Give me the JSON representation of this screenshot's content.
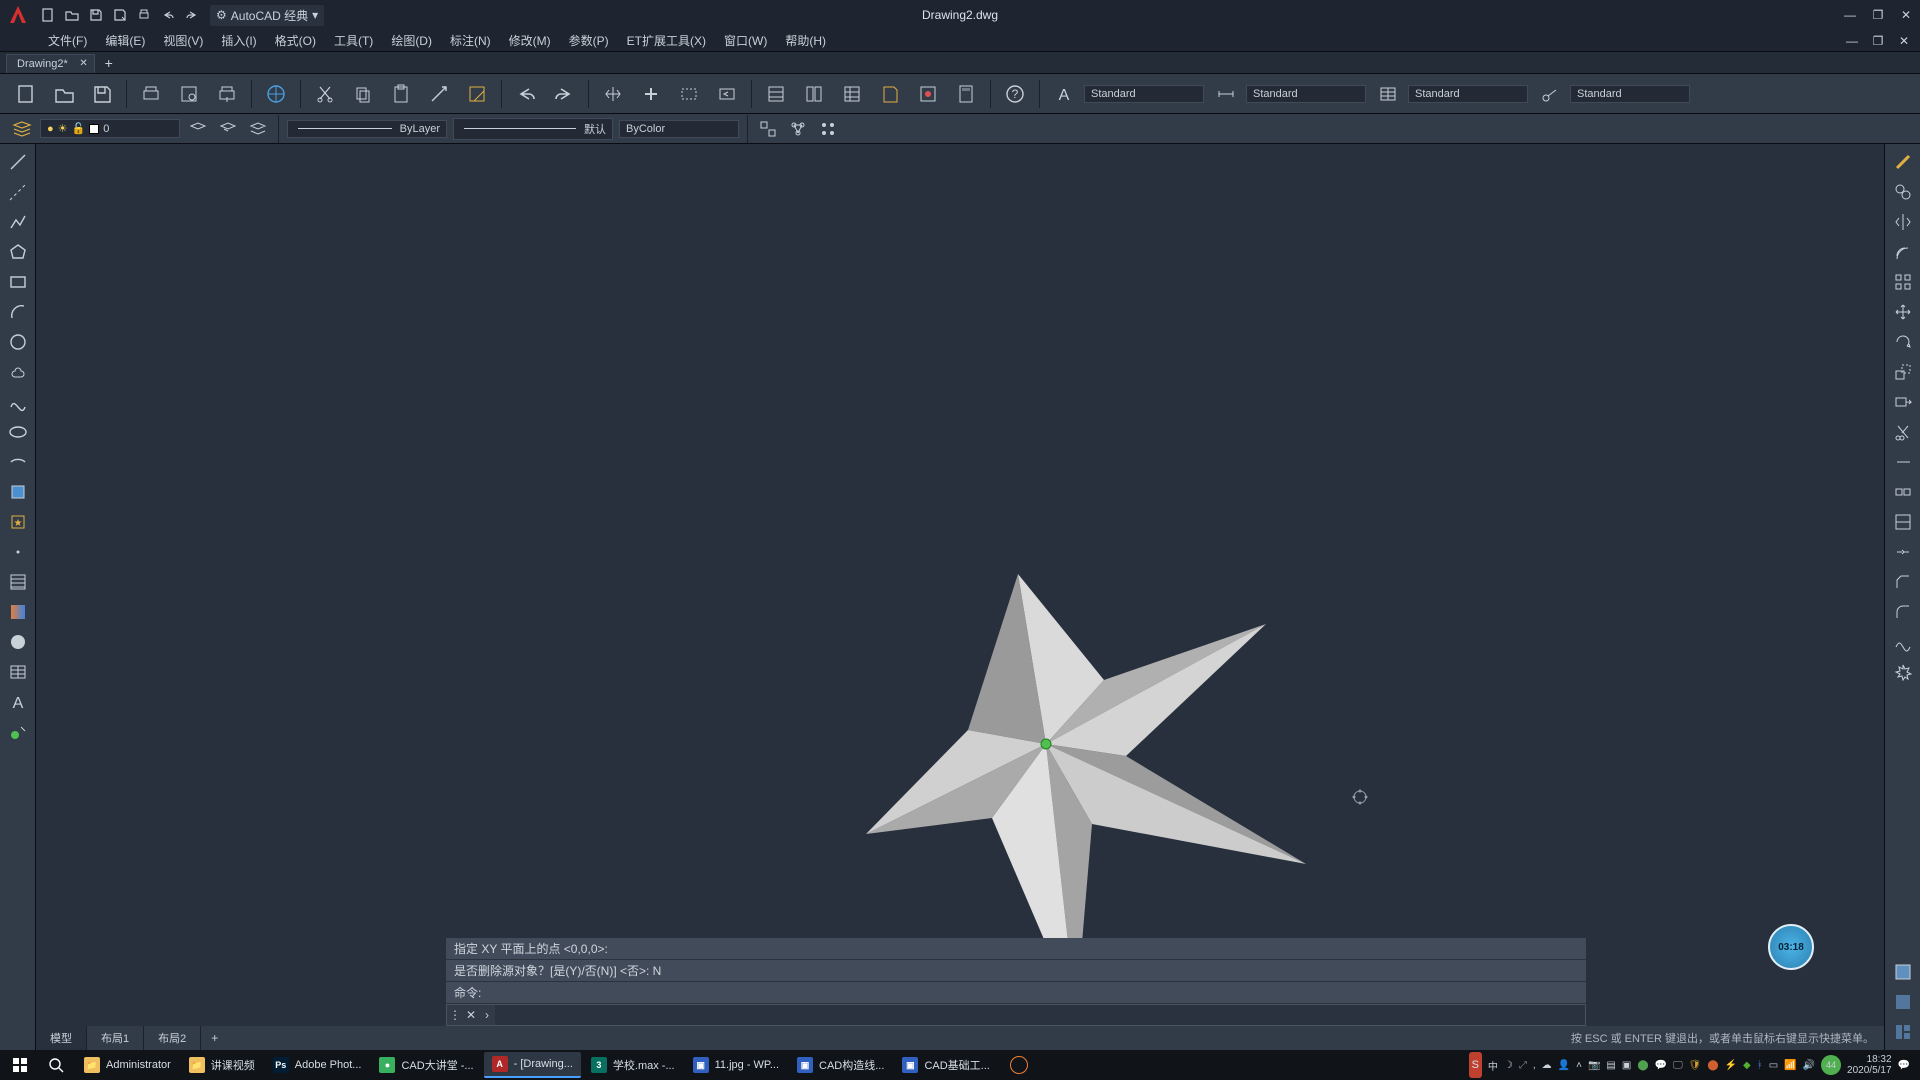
{
  "title": "Drawing2.dwg",
  "workspace": "AutoCAD 经典",
  "menus": [
    "文件(F)",
    "编辑(E)",
    "视图(V)",
    "插入(I)",
    "格式(O)",
    "工具(T)",
    "绘图(D)",
    "标注(N)",
    "修改(M)",
    "参数(P)",
    "ET扩展工具(X)",
    "窗口(W)",
    "帮助(H)"
  ],
  "doctab": "Drawing2*",
  "styles": {
    "text": "Standard",
    "dim": "Standard",
    "table": "Standard",
    "mleader": "Standard"
  },
  "layer": {
    "current": "0",
    "linetype": "ByLayer",
    "lineweight": "默认",
    "color": "ByColor"
  },
  "cmd": {
    "line1": "指定 XY 平面上的点 <0,0,0>:",
    "line2": "是否删除源对象？[是(Y)/否(N)] <否>: N",
    "line3": "命令:"
  },
  "layout_tabs": [
    "模型",
    "布局1",
    "布局2"
  ],
  "hint": "按 ESC 或 ENTER 键退出，或者单击鼠标右键显示快捷菜单。",
  "timer": "03:18",
  "taskbar": {
    "items": [
      {
        "label": "Administrator",
        "icon": "folder",
        "color": "#f0c060"
      },
      {
        "label": "讲课视频",
        "icon": "folder",
        "color": "#f0c060"
      },
      {
        "label": "Adobe Phot...",
        "icon": "ps",
        "color": "#001d34"
      },
      {
        "label": "CAD大讲堂 -...",
        "icon": "circle",
        "color": "#38b060"
      },
      {
        "label": "- [Drawing...",
        "icon": "a",
        "color": "#b02828",
        "active": true
      },
      {
        "label": "学校.max -...",
        "icon": "3",
        "color": "#087060"
      },
      {
        "label": "11.jpg - WP...",
        "icon": "img",
        "color": "#3060c0"
      },
      {
        "label": "CAD构造线...",
        "icon": "img",
        "color": "#3060c0"
      },
      {
        "label": "CAD基础工...",
        "icon": "img",
        "color": "#3060c0"
      }
    ],
    "ime": "中",
    "time": "18:32",
    "date": "2020/5/17"
  }
}
